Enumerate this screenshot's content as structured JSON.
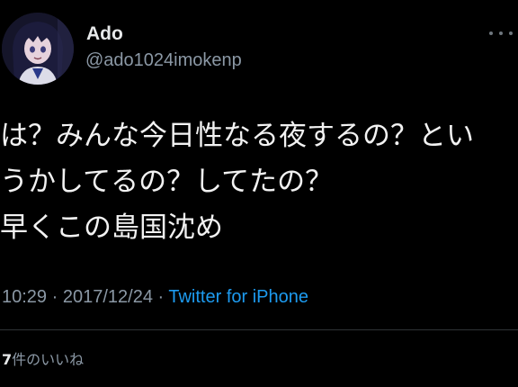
{
  "tweet": {
    "author": {
      "display_name": "Ado",
      "handle": "@ado1024imokenp",
      "avatar_icon": "anime-girl-avatar"
    },
    "more_icon": "ellipsis-icon",
    "text_lines": [
      "は？みんな今日性なる夜するの？とい",
      "うかしてるの？してたの？",
      "早くこの島国沈め"
    ],
    "meta": {
      "time": "10:29",
      "date": "2017/12/24",
      "separator": " · ",
      "source": "Twitter for iPhone"
    },
    "likes": {
      "count": "7",
      "label": "件のいいね"
    }
  },
  "colors": {
    "background": "#000000",
    "primary_text": "#e7e9ea",
    "secondary_text": "#8b98a5",
    "link": "#1d9bf0",
    "divider": "#2f3336"
  }
}
